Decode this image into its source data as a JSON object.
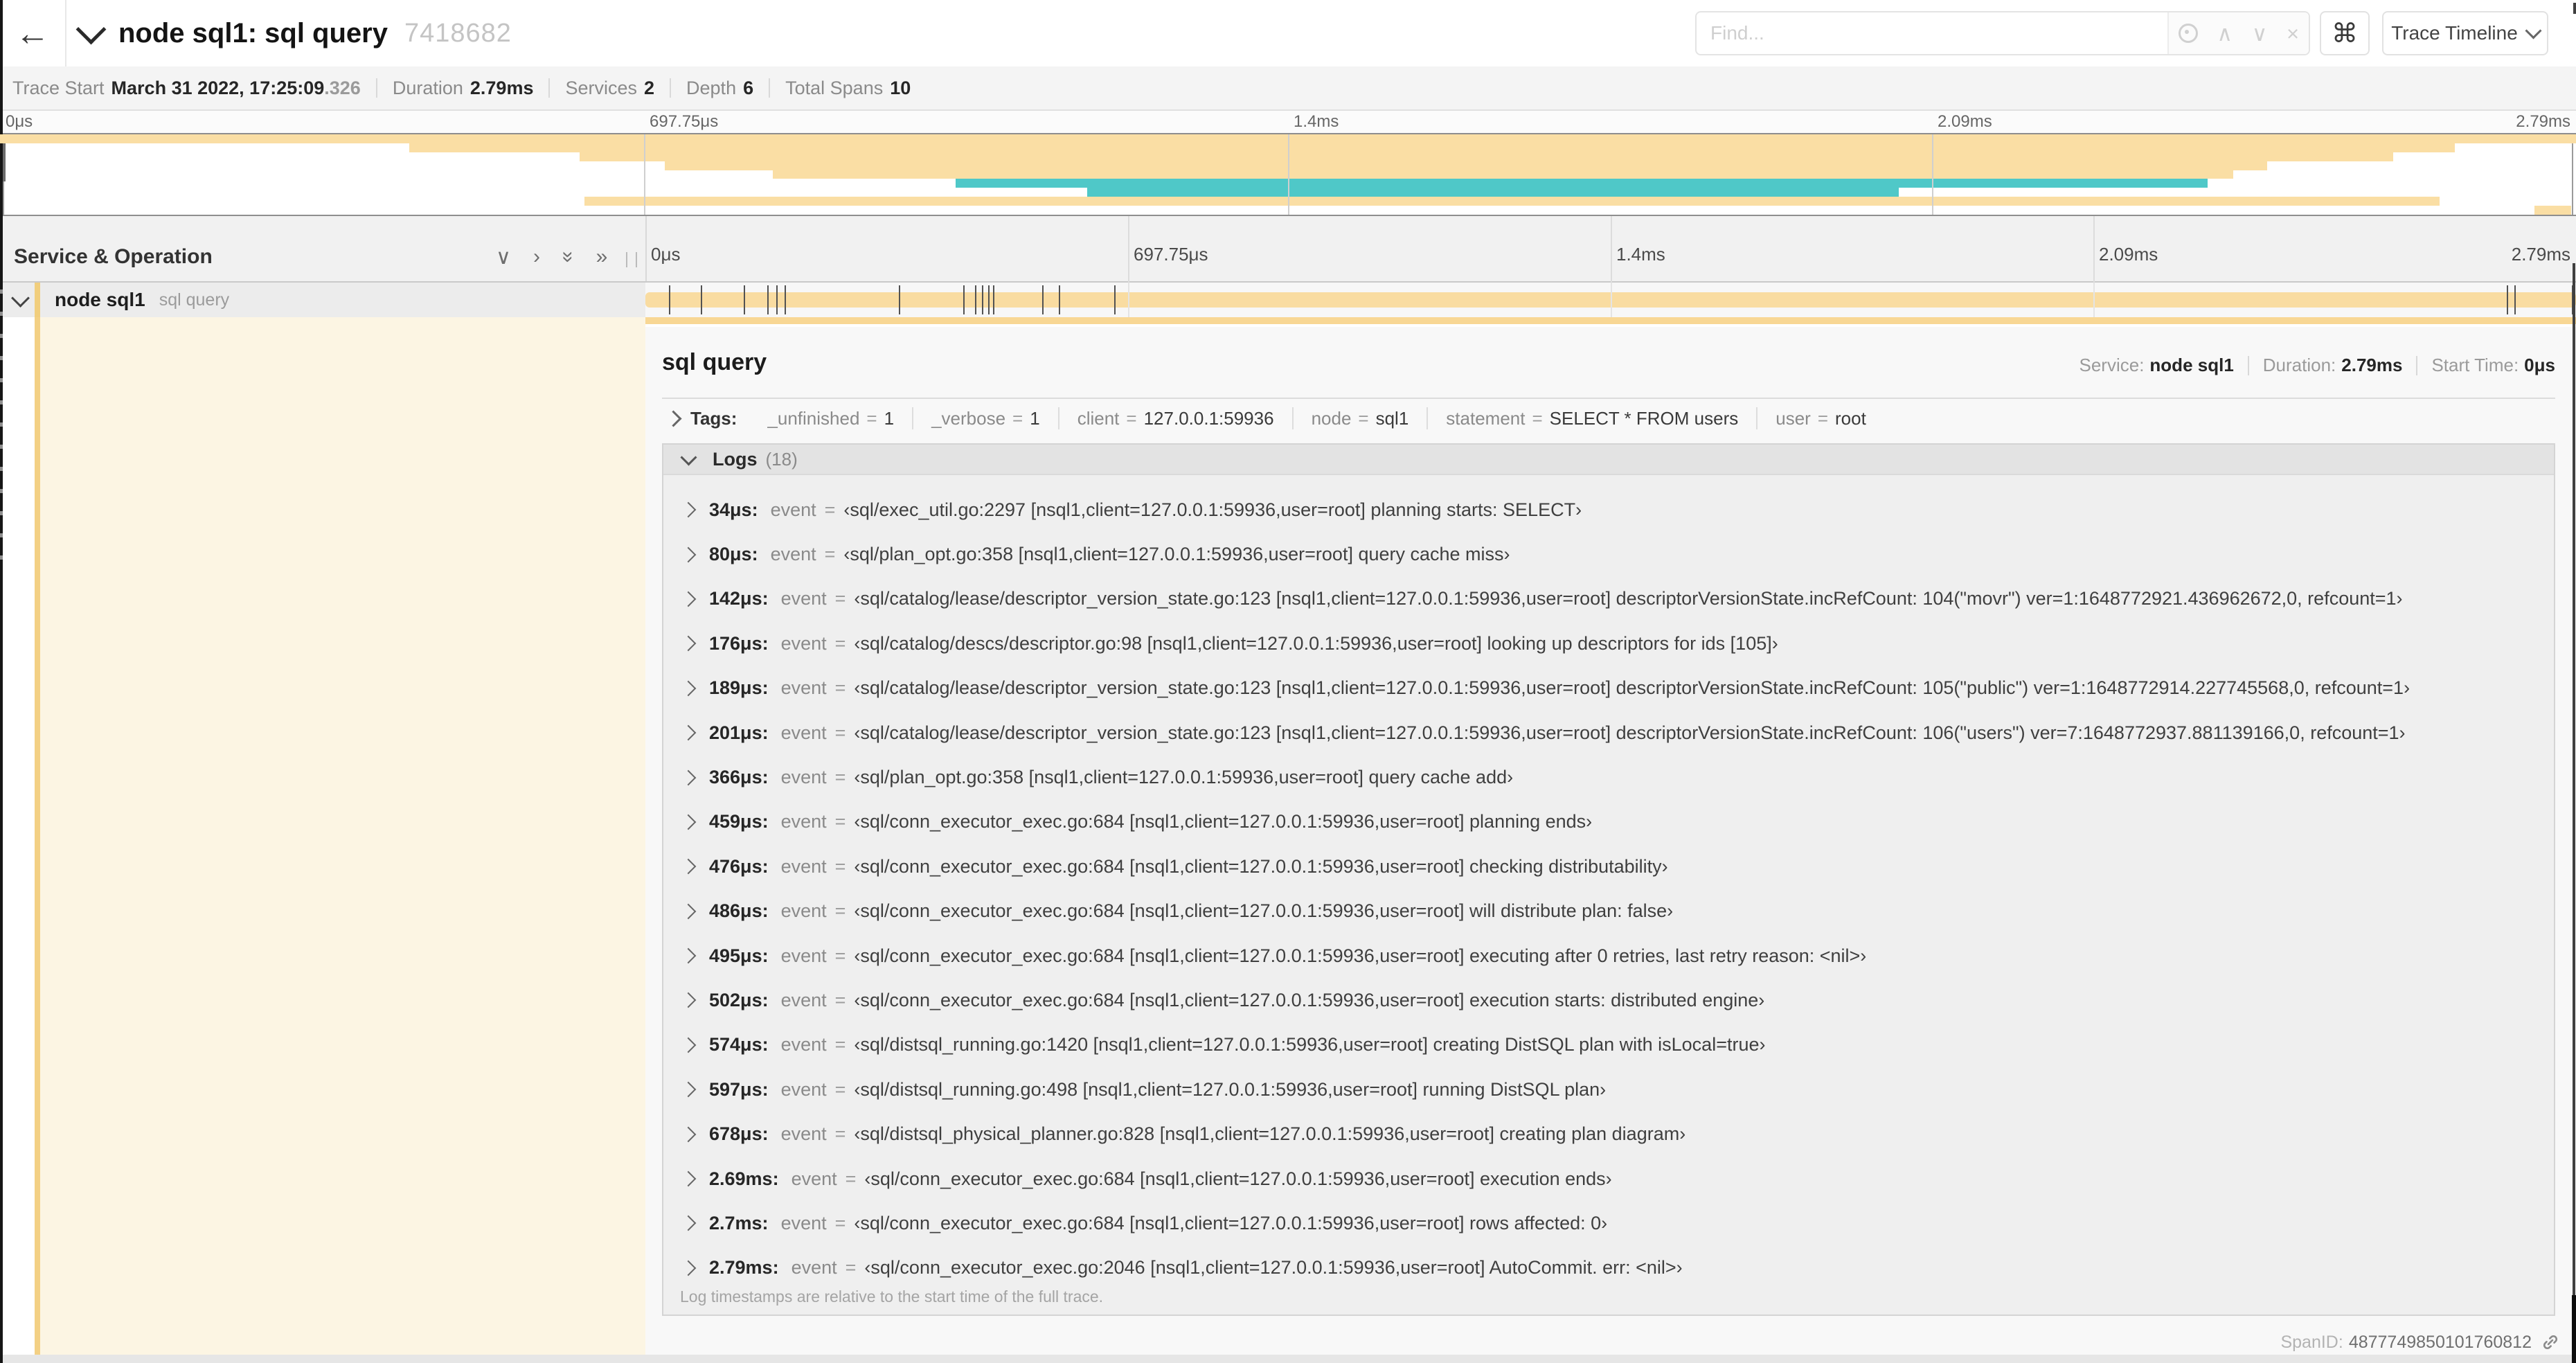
{
  "header": {
    "title": "node sql1: sql query",
    "trace_id_short": "7418682",
    "find_placeholder": "Find...",
    "command_glyph": "⌘",
    "view_selector": "Trace Timeline"
  },
  "summary": {
    "items": [
      {
        "label": "Trace Start",
        "value": "March 31 2022, 17:25:09",
        "suffix": ".326"
      },
      {
        "label": "Duration",
        "value": "2.79ms"
      },
      {
        "label": "Services",
        "value": "2"
      },
      {
        "label": "Depth",
        "value": "6"
      },
      {
        "label": "Total Spans",
        "value": "10"
      }
    ]
  },
  "ruler": {
    "ticks": [
      {
        "label": "0μs",
        "pos": 0
      },
      {
        "label": "697.75μs",
        "pos": 25
      },
      {
        "label": "1.4ms",
        "pos": 50
      },
      {
        "label": "2.09ms",
        "pos": 75
      },
      {
        "label": "2.79ms",
        "pos": 100
      }
    ]
  },
  "minimap": {
    "colors": {
      "yellow": "#fadea4",
      "teal": "#4fc8c8"
    },
    "bars": [
      {
        "start": 0,
        "end": 100,
        "color": "yellow"
      },
      {
        "start": 15.9,
        "end": 95.3,
        "color": "yellow"
      },
      {
        "start": 22.5,
        "end": 92.9,
        "color": "yellow"
      },
      {
        "start": 25.8,
        "end": 88.0,
        "color": "yellow"
      },
      {
        "start": 30.0,
        "end": 86.7,
        "color": "yellow"
      },
      {
        "start": 37.1,
        "end": 85.7,
        "color": "teal"
      },
      {
        "start": 42.2,
        "end": 73.7,
        "color": "teal"
      },
      {
        "start": 22.7,
        "end": 94.7,
        "color": "yellow"
      },
      {
        "start": 98.4,
        "end": 99.8,
        "color": "yellow"
      }
    ]
  },
  "tree_header": {
    "label": "Service & Operation"
  },
  "span_row": {
    "service": "node sql1",
    "operation": "sql query",
    "tick_positions": [
      1.22,
      2.87,
      5.09,
      6.31,
      6.77,
      7.2,
      13.12,
      16.45,
      17.06,
      17.42,
      17.74,
      17.99,
      20.57,
      21.4,
      24.3,
      96.4,
      96.8,
      99.8
    ]
  },
  "detail": {
    "title": "sql query",
    "meta": [
      {
        "label": "Service:",
        "value": "node sql1"
      },
      {
        "label": "Duration:",
        "value": "2.79ms"
      },
      {
        "label": "Start Time:",
        "value": "0μs"
      }
    ],
    "tags": {
      "label": "Tags:",
      "items": [
        {
          "key": "_unfinished",
          "value": "1"
        },
        {
          "key": "_verbose",
          "value": "1"
        },
        {
          "key": "client",
          "value": "127.0.0.1:59936"
        },
        {
          "key": "node",
          "value": "sql1"
        },
        {
          "key": "statement",
          "value": "SELECT * FROM users"
        },
        {
          "key": "user",
          "value": "root"
        }
      ]
    },
    "logs": {
      "label": "Logs",
      "count": "(18)",
      "rows": [
        {
          "ts": "34μs:",
          "key": "event",
          "value": "‹sql/exec_util.go:2297 [nsql1,client=127.0.0.1:59936,user=root] planning starts: SELECT›"
        },
        {
          "ts": "80μs:",
          "key": "event",
          "value": "‹sql/plan_opt.go:358 [nsql1,client=127.0.0.1:59936,user=root] query cache miss›"
        },
        {
          "ts": "142μs:",
          "key": "event",
          "value": "‹sql/catalog/lease/descriptor_version_state.go:123 [nsql1,client=127.0.0.1:59936,user=root] descriptorVersionState.incRefCount: 104(\"movr\") ver=1:1648772921.436962672,0, refcount=1›"
        },
        {
          "ts": "176μs:",
          "key": "event",
          "value": "‹sql/catalog/descs/descriptor.go:98 [nsql1,client=127.0.0.1:59936,user=root] looking up descriptors for ids [105]›"
        },
        {
          "ts": "189μs:",
          "key": "event",
          "value": "‹sql/catalog/lease/descriptor_version_state.go:123 [nsql1,client=127.0.0.1:59936,user=root] descriptorVersionState.incRefCount: 105(\"public\") ver=1:1648772914.227745568,0, refcount=1›"
        },
        {
          "ts": "201μs:",
          "key": "event",
          "value": "‹sql/catalog/lease/descriptor_version_state.go:123 [nsql1,client=127.0.0.1:59936,user=root] descriptorVersionState.incRefCount: 106(\"users\") ver=7:1648772937.881139166,0, refcount=1›"
        },
        {
          "ts": "366μs:",
          "key": "event",
          "value": "‹sql/plan_opt.go:358 [nsql1,client=127.0.0.1:59936,user=root] query cache add›"
        },
        {
          "ts": "459μs:",
          "key": "event",
          "value": "‹sql/conn_executor_exec.go:684 [nsql1,client=127.0.0.1:59936,user=root] planning ends›"
        },
        {
          "ts": "476μs:",
          "key": "event",
          "value": "‹sql/conn_executor_exec.go:684 [nsql1,client=127.0.0.1:59936,user=root] checking distributability›"
        },
        {
          "ts": "486μs:",
          "key": "event",
          "value": "‹sql/conn_executor_exec.go:684 [nsql1,client=127.0.0.1:59936,user=root] will distribute plan: false›"
        },
        {
          "ts": "495μs:",
          "key": "event",
          "value": "‹sql/conn_executor_exec.go:684 [nsql1,client=127.0.0.1:59936,user=root] executing after 0 retries, last retry reason: <nil>›"
        },
        {
          "ts": "502μs:",
          "key": "event",
          "value": "‹sql/conn_executor_exec.go:684 [nsql1,client=127.0.0.1:59936,user=root] execution starts: distributed engine›"
        },
        {
          "ts": "574μs:",
          "key": "event",
          "value": "‹sql/distsql_running.go:1420 [nsql1,client=127.0.0.1:59936,user=root] creating DistSQL plan with isLocal=true›"
        },
        {
          "ts": "597μs:",
          "key": "event",
          "value": "‹sql/distsql_running.go:498 [nsql1,client=127.0.0.1:59936,user=root] running DistSQL plan›"
        },
        {
          "ts": "678μs:",
          "key": "event",
          "value": "‹sql/distsql_physical_planner.go:828 [nsql1,client=127.0.0.1:59936,user=root] creating plan diagram›"
        },
        {
          "ts": "2.69ms:",
          "key": "event",
          "value": "‹sql/conn_executor_exec.go:684 [nsql1,client=127.0.0.1:59936,user=root] execution ends›"
        },
        {
          "ts": "2.7ms:",
          "key": "event",
          "value": "‹sql/conn_executor_exec.go:684 [nsql1,client=127.0.0.1:59936,user=root] rows affected: 0›"
        },
        {
          "ts": "2.79ms:",
          "key": "event",
          "value": "‹sql/conn_executor_exec.go:2046 [nsql1,client=127.0.0.1:59936,user=root] AutoCommit. err: <nil>›"
        }
      ],
      "footnote": "Log timestamps are relative to the start time of the full trace."
    },
    "span_id_label": "SpanID:",
    "span_id": "4877749850101760812"
  }
}
